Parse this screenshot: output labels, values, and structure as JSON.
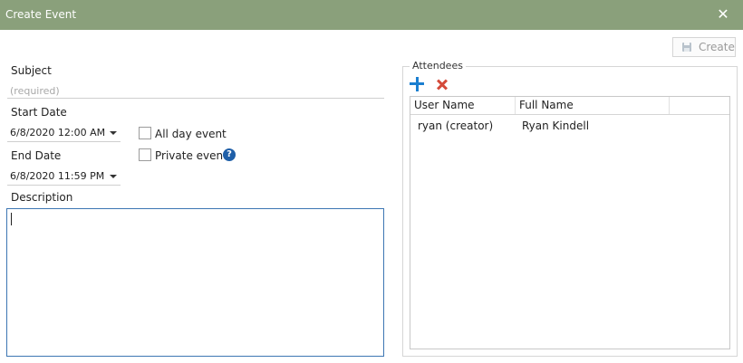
{
  "window": {
    "title": "Create Event",
    "close_glyph": "✕"
  },
  "toolbar": {
    "create_label": "Create"
  },
  "form": {
    "subject_label": "Subject",
    "subject_placeholder": "(required)",
    "start_date_label": "Start Date",
    "start_date_value": "6/8/2020 12:00 AM",
    "end_date_label": "End Date",
    "end_date_value": "6/8/2020 11:59 PM",
    "all_day_label": "All day event",
    "all_day_checked": false,
    "private_label": "Private event",
    "private_checked": false,
    "help_glyph": "?",
    "description_label": "Description",
    "description_value": ""
  },
  "attendees": {
    "legend": "Attendees",
    "columns": [
      "User Name",
      "Full Name"
    ],
    "rows": [
      {
        "user_name": "ryan (creator)",
        "full_name": "Ryan Kindell"
      }
    ]
  },
  "colors": {
    "titlebar": "#8aa07b",
    "focus_border": "#3d76b3",
    "add_icon": "#1b7fd0",
    "remove_icon": "#d44a3a",
    "help_icon": "#1f5fa8"
  }
}
